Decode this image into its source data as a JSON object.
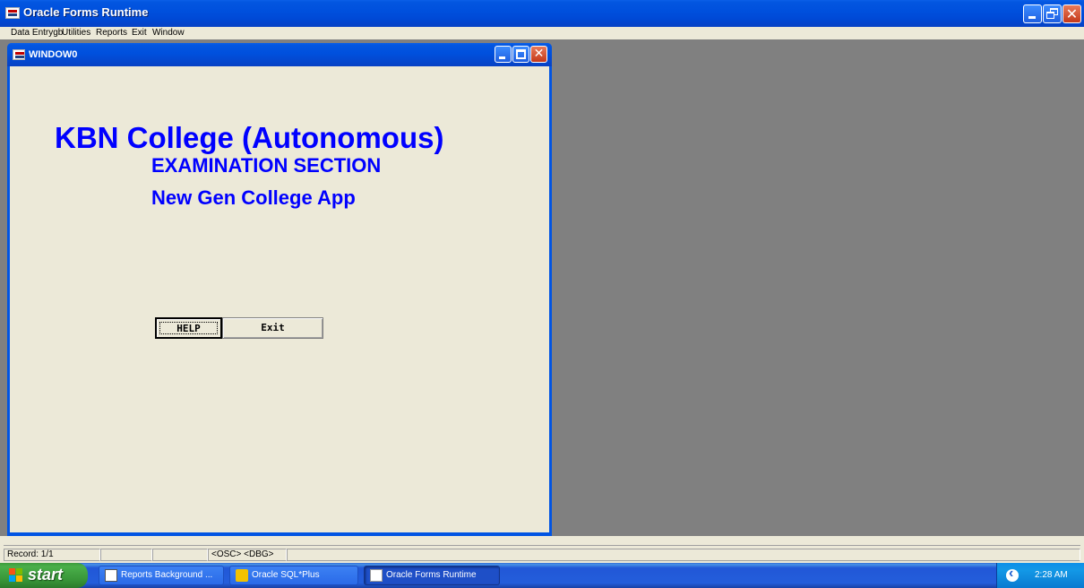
{
  "app": {
    "title": "Oracle Forms Runtime",
    "icon": "oracle-forms-icon"
  },
  "window_controls": {
    "minimize_icon": "minimize-icon",
    "restore_icon": "restore-icon",
    "maximize_icon": "maximize-icon",
    "close_icon": "close-icon",
    "close_glyph": "✕"
  },
  "menu": {
    "items": [
      "Data Entrygb",
      "Utilities",
      "Reports",
      "Exit",
      "Window"
    ]
  },
  "form_window": {
    "title": "WINDOW0",
    "headings": {
      "college": "KBN College (Autonomous)",
      "section": "EXAMINATION SECTION",
      "app": "New Gen College App"
    },
    "buttons": {
      "help": "HELP",
      "exit": "Exit"
    }
  },
  "status_bar": {
    "cells": [
      "Record: 1/1",
      "",
      "",
      "<OSC> <DBG>",
      ""
    ]
  },
  "taskbar": {
    "start_label": "start",
    "tasks": [
      {
        "label": "Reports Background ...",
        "icon": "reports-icon",
        "active": false
      },
      {
        "label": "Oracle SQL*Plus",
        "icon": "sqlplus-icon",
        "active": false
      },
      {
        "label": "Oracle Forms Runtime",
        "icon": "oracle-forms-icon",
        "active": true
      }
    ],
    "tray_icon": "show-hidden-icons-icon",
    "clock": "2:28 AM"
  },
  "colors": {
    "heading_blue": "#0000ff",
    "xp_titlebar": "#0054e3",
    "mdi_background": "#808080",
    "dialog_face": "#ece9d8"
  }
}
